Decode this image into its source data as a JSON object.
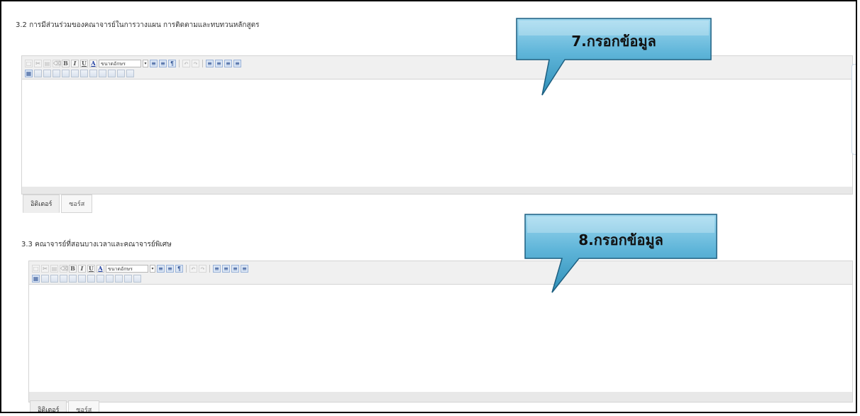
{
  "sections": [
    {
      "title": "3.2 การมีส่วนร่วมของคณาจารย์ในการวางแผน การติดตามและทบทวนหลักสูตร",
      "font_size_label": "ขนาดอักษร",
      "tabs": [
        "อิดิเตอร์",
        "ซอร์ส"
      ],
      "callout": "7.กรอกข้อมูล"
    },
    {
      "title": "3.3 คณาจารย์ที่สอนบางเวลาและคณาจารย์พิเศษ",
      "font_size_label": "ขนาดอักษร",
      "tabs": [
        "อิดิเตอร์",
        "ซอร์ส"
      ],
      "callout": "8.กรอกข้อมูล"
    }
  ],
  "toolbar_icons_row1": [
    "new-page-icon",
    "cut-icon",
    "paste-icon",
    "eraser-icon",
    "bold-icon",
    "italic-icon",
    "underline-icon",
    "text-color-icon",
    "font-size-select",
    "numbered-list-icon",
    "bullet-list-icon",
    "paragraph-icon",
    "undo-icon",
    "redo-icon",
    "align-left-icon",
    "align-center-icon",
    "align-right-icon",
    "justify-icon"
  ],
  "toolbar_icons_row2": [
    "table-icon",
    "insert-row-before-icon",
    "insert-row-after-icon",
    "insert-column-before-icon",
    "insert-column-after-icon",
    "delete-row-icon",
    "delete-column-icon",
    "merge-cells-icon",
    "split-cell-icon",
    "cell-properties-icon",
    "table-properties-icon",
    "delete-table-icon"
  ],
  "colors": {
    "callout_fill_top": "#7ec9e6",
    "callout_fill_bottom": "#2f8fb8",
    "callout_border": "#1d5f80",
    "frame_border": "#000000"
  }
}
